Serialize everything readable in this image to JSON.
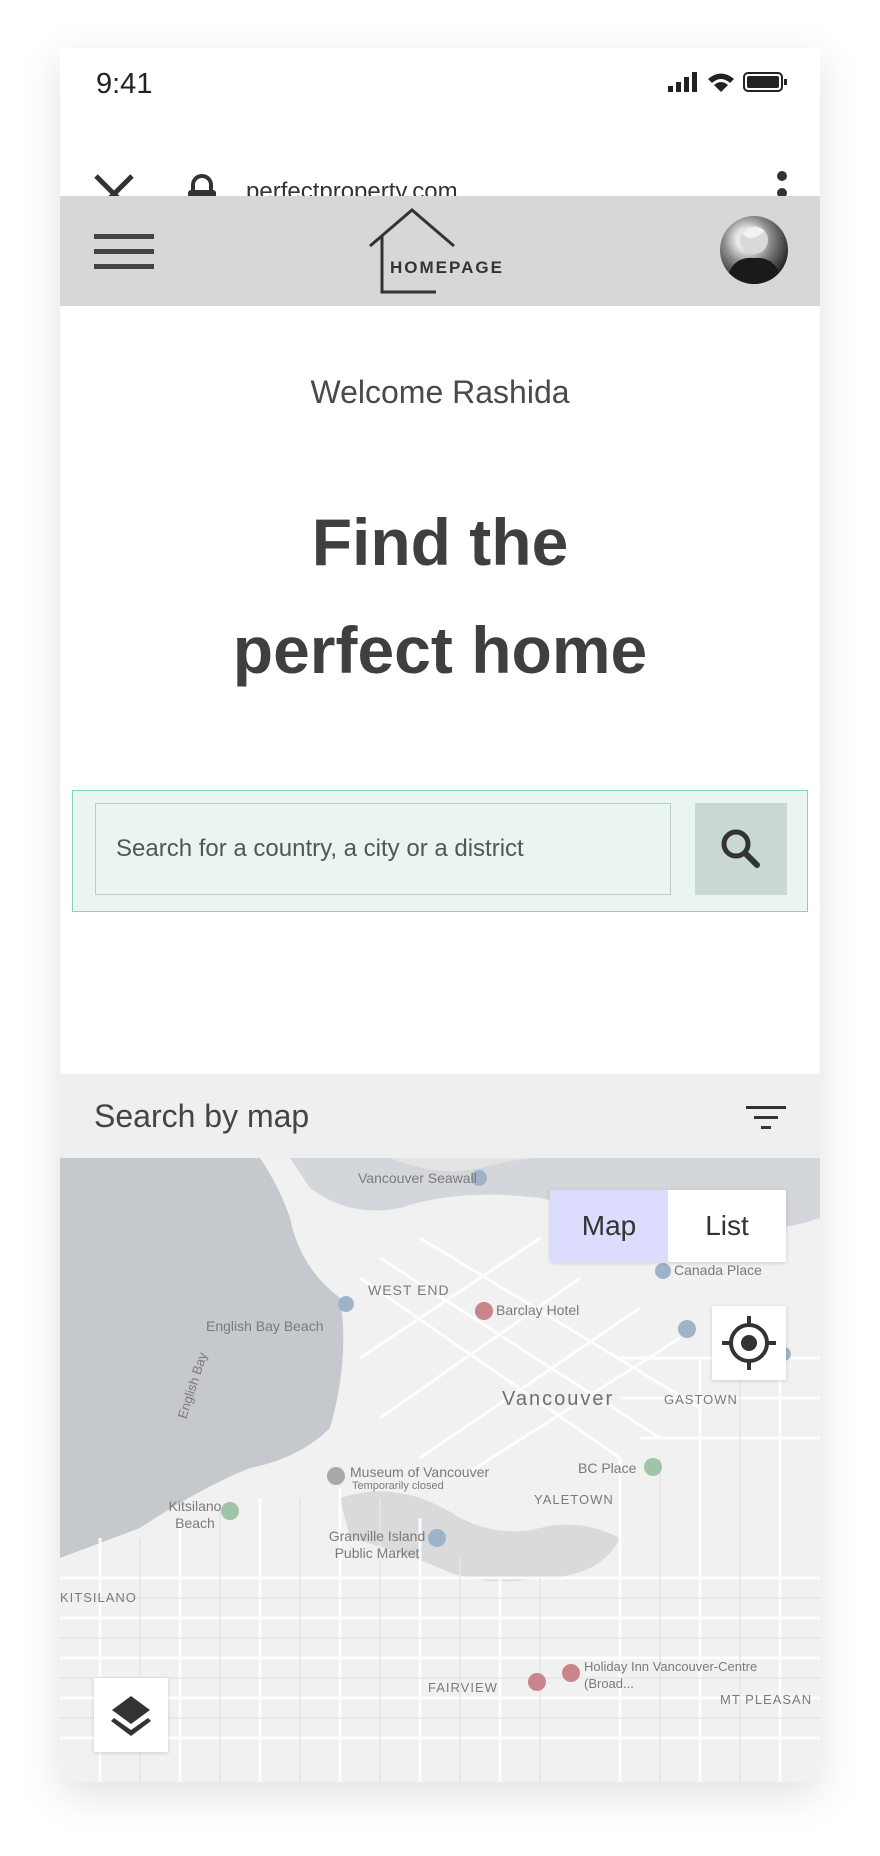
{
  "status_bar": {
    "time": "9:41"
  },
  "browser": {
    "url": "perfectproperty.com"
  },
  "app": {
    "logo_text": "HOMEPAGE"
  },
  "hero": {
    "welcome": "Welcome Rashida",
    "headline_line1": "Find the",
    "headline_line2": "perfect home"
  },
  "search": {
    "placeholder": "Search for a country, a city or a district"
  },
  "map_section": {
    "title": "Search by map",
    "toggle_map": "Map",
    "toggle_list": "List",
    "labels": {
      "seawall": "Vancouver Seawall",
      "west_end": "WEST END",
      "barclay": "Barclay Hotel",
      "canada_place": "Canada Place",
      "english_bay_beach": "English Bay Beach",
      "english_bay": "English Bay",
      "vancouver": "Vancouver",
      "gastown": "GASTOWN",
      "museum": "Museum of Vancouver",
      "museum_note": "Temporarily closed",
      "bc_place": "BC Place",
      "yaletown": "YALETOWN",
      "kitsilano_beach": "Kitsilano Beach",
      "granville": "Granville Island Public Market",
      "kitsilano": "KITSILANO",
      "fairview": "FAIRVIEW",
      "holiday_inn": "Holiday Inn Vancouver-Centre (Broad...",
      "mt_pleasant": "MT PLEASAN"
    }
  },
  "colors": {
    "app_bar": "#d7d7d7",
    "search_bg": "#eaf5f2",
    "search_border": "#7fd5c0",
    "toggle_active": "#dcdcff",
    "text_dark": "#3f3f3f"
  }
}
